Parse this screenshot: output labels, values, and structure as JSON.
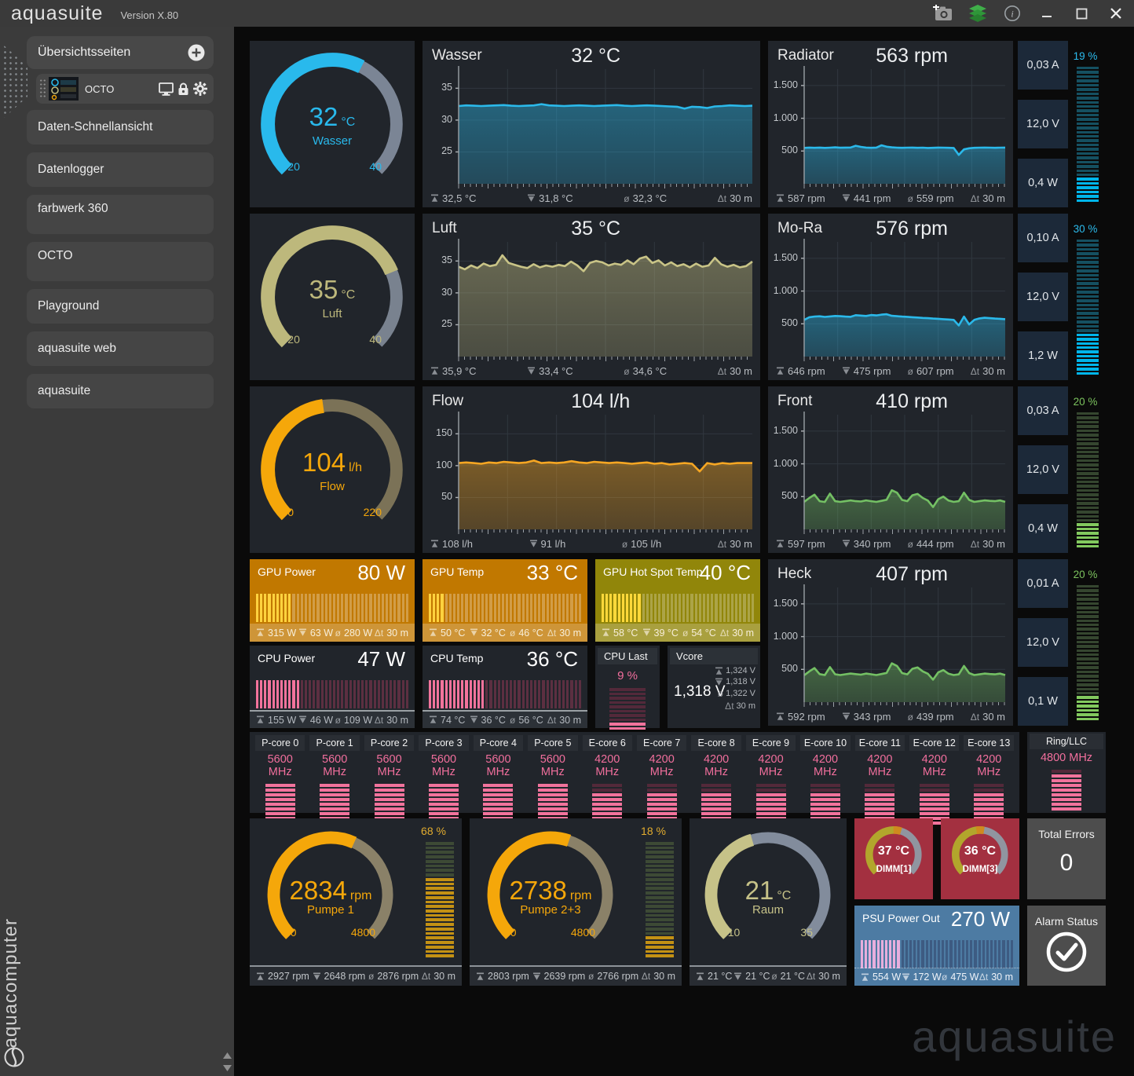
{
  "titlebar": {
    "app": "aquasuite",
    "version": "Version X.80"
  },
  "sidebar": {
    "header": "Übersichtsseiten",
    "device": "OCTO",
    "items": [
      {
        "label": "Daten-Schnellansicht",
        "tall": false
      },
      {
        "label": "Datenlogger",
        "tall": false
      },
      {
        "label": "farbwerk 360",
        "tall": true
      },
      {
        "label": "OCTO",
        "tall": true
      },
      {
        "label": "Playground",
        "tall": false
      },
      {
        "label": "aquasuite web",
        "tall": false
      },
      {
        "label": "aquasuite",
        "tall": false
      }
    ],
    "brand": "aquacomputer"
  },
  "watermark": "aquasuite",
  "meters": {
    "cyan": {
      "label": "#2cbcee",
      "on": "#00b5ea",
      "off": "#155061"
    },
    "green": {
      "label": "#7cc35e",
      "on": "#82c95e",
      "off": "#35462f"
    },
    "yellow": {
      "label": "#e2ac2f",
      "on": "#c39114",
      "off": "#3f4c36"
    },
    "pink": {
      "label": "#f26f9d",
      "on": "#f2739c",
      "off": "#53293a"
    }
  },
  "gauges": {
    "wasser": {
      "value": "32",
      "unit": "°C",
      "name": "Wasser",
      "min": "20",
      "max": "40",
      "fraction": 0.6,
      "color": "#29b9ec",
      "track": "#7b8595"
    },
    "luft": {
      "value": "35",
      "unit": "°C",
      "name": "Luft",
      "min": "20",
      "max": "40",
      "fraction": 0.75,
      "color": "#bdb87c",
      "track": "#79828f"
    },
    "flow": {
      "value": "104",
      "unit": "l/h",
      "name": "Flow",
      "min": "0",
      "max": "220",
      "fraction": 0.47,
      "color": "#f5a70a",
      "track": "#7b7257"
    },
    "raum": {
      "value": "21",
      "unit": "°C",
      "name": "Raum",
      "min": "10",
      "max": "35",
      "fraction": 0.44,
      "color": "#c6c288",
      "track": "#828c9c"
    }
  },
  "chart_data": [
    {
      "key": "wasser",
      "type": "area",
      "title": "Wasser",
      "current": "32 °C",
      "color": "#2bb9ea",
      "ylim": [
        20,
        38
      ],
      "yticks": [
        {
          "v": 35,
          "label": "35"
        },
        {
          "v": 30,
          "label": "30"
        },
        {
          "v": 25,
          "label": "25"
        }
      ],
      "values": [
        32.2,
        32.3,
        32.25,
        32.2,
        32.25,
        32.3,
        32.35,
        32.25,
        32.2,
        32.25,
        32.3,
        32.5,
        32.3,
        32.25,
        32.2,
        32.25,
        32.3,
        32.25,
        32.2,
        32.25,
        32.3,
        32.35,
        32.25,
        32.2,
        32.25,
        32.3,
        32.25,
        32.2,
        32.15,
        32.1,
        31.8,
        32.1,
        32.05,
        31.9,
        32.15,
        32.2,
        32.3,
        32.25,
        32.2,
        32.25
      ],
      "stats": {
        "max": "32,5 °C",
        "min": "31,8 °C",
        "avg": "32,3 °C",
        "dt": "30 m"
      }
    },
    {
      "key": "luft",
      "type": "area",
      "title": "Luft",
      "current": "35 °C",
      "color": "#c9c487",
      "ylim": [
        20,
        38
      ],
      "yticks": [
        {
          "v": 35,
          "label": "35"
        },
        {
          "v": 30,
          "label": "30"
        },
        {
          "v": 25,
          "label": "25"
        }
      ],
      "values": [
        34.1,
        33.7,
        34.3,
        33.9,
        34.6,
        34.2,
        34.4,
        35.9,
        34.7,
        34.4,
        34.1,
        33.9,
        34.5,
        34.0,
        34.3,
        34.1,
        34.4,
        34.2,
        34.9,
        34.3,
        33.4,
        34.7,
        35.0,
        34.8,
        34.3,
        34.6,
        34.4,
        35.1,
        34.5,
        35.4,
        35.7,
        34.7,
        35.1,
        34.3,
        34.8,
        34.2,
        34.5,
        34.0,
        34.6,
        34.1,
        34.3,
        35.5,
        34.5,
        34.1,
        34.4,
        34.0,
        34.2,
        34.9
      ],
      "stats": {
        "max": "35,9 °C",
        "min": "33,4 °C",
        "avg": "34,6 °C",
        "dt": "30 m"
      }
    },
    {
      "key": "flow",
      "type": "area",
      "title": "Flow",
      "current": "104 l/h",
      "color": "#f5a623",
      "ylim": [
        0,
        180
      ],
      "yticks": [
        {
          "v": 150,
          "label": "150"
        },
        {
          "v": 100,
          "label": "100"
        },
        {
          "v": 50,
          "label": "50"
        }
      ],
      "values": [
        104,
        105,
        104,
        103,
        105,
        104,
        106,
        105,
        104,
        105,
        108,
        104,
        105,
        104,
        105,
        107,
        105,
        104,
        106,
        105,
        104,
        105,
        104,
        103,
        104,
        105,
        103,
        104,
        102,
        103,
        104,
        103,
        91,
        104,
        102,
        104,
        103,
        104,
        104,
        104
      ],
      "stats": {
        "max": "108 l/h",
        "min": "91 l/h",
        "avg": "105 l/h",
        "dt": "30 m"
      }
    },
    {
      "key": "radiator",
      "type": "area",
      "title": "Radiator",
      "current": "563 rpm",
      "color": "#2bb9ea",
      "ylim": [
        0,
        1750
      ],
      "yticks": [
        {
          "v": 1500,
          "label": "1.500"
        },
        {
          "v": 1000,
          "label": "1.000"
        },
        {
          "v": 500,
          "label": "500"
        }
      ],
      "values": [
        548,
        552,
        549,
        553,
        548,
        551,
        556,
        550,
        552,
        554,
        580,
        563,
        552,
        549,
        553,
        587,
        566,
        556,
        551,
        549,
        551,
        553,
        549,
        551,
        546,
        549,
        553,
        551,
        549,
        546,
        441,
        525,
        542,
        549,
        551,
        553,
        551,
        549,
        551,
        553
      ],
      "stats": {
        "max": "587 rpm",
        "min": "441 rpm",
        "avg": "559 rpm",
        "dt": "30 m"
      }
    },
    {
      "key": "mora",
      "type": "area",
      "title": "Mo-Ra",
      "current": "576 rpm",
      "color": "#2bb9ea",
      "ylim": [
        0,
        1750
      ],
      "yticks": [
        {
          "v": 1500,
          "label": "1.500"
        },
        {
          "v": 1000,
          "label": "1.000"
        },
        {
          "v": 500,
          "label": "500"
        }
      ],
      "values": [
        560,
        600,
        610,
        615,
        605,
        612,
        620,
        616,
        610,
        606,
        632,
        626,
        620,
        634,
        628,
        640,
        646,
        622,
        616,
        610,
        606,
        600,
        596,
        590,
        586,
        580,
        576,
        570,
        566,
        560,
        475,
        610,
        490,
        560,
        582,
        592,
        586,
        580,
        576,
        570
      ],
      "stats": {
        "max": "646 rpm",
        "min": "475 rpm",
        "avg": "607 rpm",
        "dt": "30 m"
      }
    },
    {
      "key": "front",
      "type": "area",
      "title": "Front",
      "current": "410 rpm",
      "color": "#74c064",
      "ylim": [
        0,
        1750
      ],
      "yticks": [
        {
          "v": 1500,
          "label": "1.500"
        },
        {
          "v": 1000,
          "label": "1.000"
        },
        {
          "v": 500,
          "label": "500"
        }
      ],
      "values": [
        420,
        480,
        530,
        430,
        418,
        545,
        430,
        420,
        430,
        442,
        430,
        425,
        442,
        430,
        420,
        435,
        452,
        597,
        560,
        450,
        430,
        520,
        540,
        480,
        440,
        340,
        460,
        500,
        440,
        420,
        430,
        560,
        450,
        420,
        430,
        442,
        435,
        430,
        442,
        420
      ],
      "stats": {
        "max": "597 rpm",
        "min": "340 rpm",
        "avg": "444 rpm",
        "dt": "30 m"
      }
    },
    {
      "key": "heck",
      "type": "area",
      "title": "Heck",
      "current": "407 rpm",
      "color": "#74c064",
      "ylim": [
        0,
        1750
      ],
      "yticks": [
        {
          "v": 1500,
          "label": "1.500"
        },
        {
          "v": 1000,
          "label": "1.000"
        },
        {
          "v": 500,
          "label": "500"
        }
      ],
      "values": [
        410,
        470,
        520,
        428,
        414,
        535,
        425,
        414,
        425,
        436,
        428,
        419,
        436,
        425,
        414,
        429,
        446,
        592,
        552,
        444,
        424,
        510,
        530,
        470,
        434,
        343,
        454,
        489,
        434,
        414,
        424,
        552,
        444,
        414,
        424,
        436,
        429,
        424,
        436,
        414
      ],
      "stats": {
        "max": "592 rpm",
        "min": "343 rpm",
        "avg": "439 rpm",
        "dt": "30 m"
      }
    }
  ],
  "side_stacks": {
    "radiator": {
      "rows": [
        "0,03 A",
        "12,0 V",
        "0,4 W"
      ],
      "pct_label": "19 %",
      "pct": 19,
      "scheme": "cyan"
    },
    "mora": {
      "rows": [
        "0,10 A",
        "12,0 V",
        "1,2 W"
      ],
      "pct_label": "30 %",
      "pct": 30,
      "scheme": "cyan"
    },
    "front": {
      "rows": [
        "0,03 A",
        "12,0 V",
        "0,4 W"
      ],
      "pct_label": "20 %",
      "pct": 20,
      "scheme": "green"
    },
    "heck": {
      "rows": [
        "0,01 A",
        "12,0 V",
        "0,1 W"
      ],
      "pct_label": "20 %",
      "pct": 20,
      "scheme": "green"
    }
  },
  "bar_tiles": {
    "gpu_power": {
      "title": "GPU Power",
      "value": "80 W",
      "style": "gpu",
      "bg": "#c17800",
      "bar_on": "#ffd23e",
      "bar_off": "rgba(255,255,255,0.28)",
      "fill": 0.24,
      "stats": {
        "max": "315 W",
        "min": "63 W",
        "avg": "280 W",
        "dt": "30 m"
      }
    },
    "gpu_temp": {
      "title": "GPU Temp",
      "value": "33 °C",
      "style": "gpu",
      "bg": "#c17800",
      "bar_on": "#ffd23e",
      "bar_off": "rgba(255,255,255,0.28)",
      "fill": 0.11,
      "stats": {
        "max": "50 °C",
        "min": "32 °C",
        "avg": "46 °C",
        "dt": "30 m"
      }
    },
    "gpu_hotspot": {
      "title": "GPU Hot Spot Temp",
      "value": "40 °C",
      "style": "gpu",
      "bg": "#91860a",
      "bar_on": "#ffd83a",
      "bar_off": "rgba(255,255,255,0.25)",
      "fill": 0.27,
      "stats": {
        "max": "58 °C",
        "min": "39 °C",
        "avg": "54 °C",
        "dt": "30 m"
      }
    },
    "cpu_power": {
      "title": "CPU Power",
      "value": "47 W",
      "style": "cpu",
      "bg": "#21252b",
      "bar_on": "#f2739c",
      "bar_off": "#5c2f41",
      "fill": 0.3,
      "stats": {
        "max": "155 W",
        "min": "46 W",
        "avg": "109 W",
        "dt": "30 m"
      }
    },
    "cpu_temp": {
      "title": "CPU Temp",
      "value": "36 °C",
      "style": "cpu",
      "bg": "#21252b",
      "bar_on": "#f2739c",
      "bar_off": "#5c2f41",
      "fill": 0.37,
      "stats": {
        "max": "74 °C",
        "min": "36 °C",
        "avg": "56 °C",
        "dt": "30 m"
      }
    },
    "psu": {
      "title": "PSU Power Out",
      "value": "270 W",
      "style": "psu",
      "bg": "#4d7ba3",
      "bar_on": "#e7aedd",
      "bar_off": "rgba(25,15,55,0.30)",
      "fill": 0.25,
      "stats": {
        "max": "554 W",
        "min": "172 W",
        "avg": "475 W",
        "dt": "30 m"
      }
    }
  },
  "cpu_last": {
    "title": "CPU Last",
    "value": "9 %",
    "fill": 0.18
  },
  "vcore": {
    "title": "Vcore",
    "value": "1,318 V",
    "stats": {
      "max": "1,324 V",
      "min": "1,318 V",
      "avg": "1,322 V",
      "dt": "30 m"
    }
  },
  "cores": {
    "items": [
      {
        "label": "P-core 0",
        "value": "5600 MHz",
        "fill": 1.0
      },
      {
        "label": "P-core 1",
        "value": "5600 MHz",
        "fill": 1.0
      },
      {
        "label": "P-core 2",
        "value": "5600 MHz",
        "fill": 1.0
      },
      {
        "label": "P-core 3",
        "value": "5600 MHz",
        "fill": 1.0
      },
      {
        "label": "P-core 4",
        "value": "5600 MHz",
        "fill": 1.0
      },
      {
        "label": "P-core 5",
        "value": "5600 MHz",
        "fill": 1.0
      },
      {
        "label": "E-core 6",
        "value": "4200 MHz",
        "fill": 0.75
      },
      {
        "label": "E-core 7",
        "value": "4200 MHz",
        "fill": 0.75
      },
      {
        "label": "E-core 8",
        "value": "4200 MHz",
        "fill": 0.75
      },
      {
        "label": "E-core 9",
        "value": "4200 MHz",
        "fill": 0.75
      },
      {
        "label": "E-core 10",
        "value": "4200 MHz",
        "fill": 0.75
      },
      {
        "label": "E-core 11",
        "value": "4200 MHz",
        "fill": 0.75
      },
      {
        "label": "E-core 12",
        "value": "4200 MHz",
        "fill": 0.75
      },
      {
        "label": "E-core 13",
        "value": "4200 MHz",
        "fill": 0.75
      }
    ],
    "ring": {
      "label": "Ring/LLC",
      "value": "4800 MHz",
      "fill": 0.86
    }
  },
  "pumps": {
    "pumpe1": {
      "value": "2834",
      "unit": "rpm",
      "name": "Pumpe 1",
      "min": "0",
      "max": "4800",
      "fraction": 0.59,
      "color": "#f5a70a",
      "track": "#8a8168",
      "pct_label": "68 %",
      "pct": 68,
      "stats": {
        "max": "2927 rpm",
        "min": "2648 rpm",
        "avg": "2876 rpm",
        "dt": "30 m"
      }
    },
    "pumpe23": {
      "value": "2738",
      "unit": "rpm",
      "name": "Pumpe 2+3",
      "min": "0",
      "max": "4800",
      "fraction": 0.57,
      "color": "#f5a70a",
      "track": "#8a8168",
      "pct_label": "18 %",
      "pct": 18,
      "stats": {
        "max": "2803 rpm",
        "min": "2639 rpm",
        "avg": "2766 rpm",
        "dt": "30 m"
      }
    }
  },
  "raum_stats": {
    "max": "21 °C",
    "min": "21 °C",
    "avg": "21 °C",
    "dt": "30 m"
  },
  "dimm": [
    {
      "value": "37 °C",
      "label": "DIMM[1]",
      "fraction": 0.55
    },
    {
      "value": "36 °C",
      "label": "DIMM[3]",
      "fraction": 0.52
    }
  ],
  "total_errors": {
    "label": "Total Errors",
    "value": "0"
  },
  "alarm": {
    "label": "Alarm Status"
  }
}
